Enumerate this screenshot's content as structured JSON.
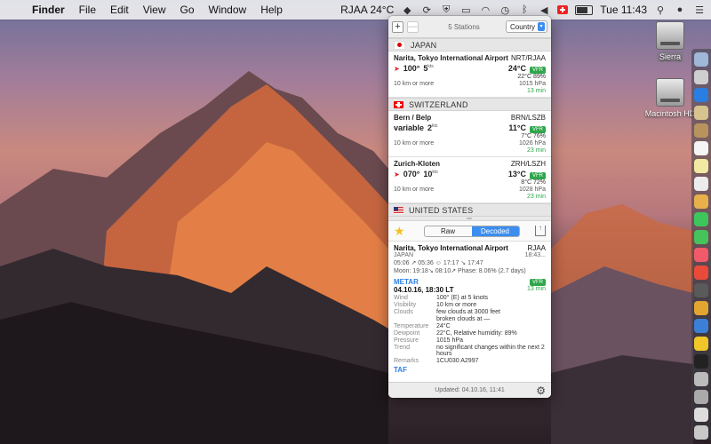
{
  "menubar": {
    "app": "Finder",
    "menus": [
      "File",
      "Edit",
      "View",
      "Go",
      "Window",
      "Help"
    ],
    "weather_status": "RJAA 24°C",
    "time": "Tue 11:43"
  },
  "panel": {
    "add_label": "+",
    "remove_label": "—",
    "stations_count": "5 Stations",
    "group_by": "Country",
    "groups": [
      {
        "country": "JAPAN",
        "stations": [
          {
            "name": "Narita, Tokyo International Airport",
            "code": "NRT/RJAA",
            "wind": "100°",
            "wind_speed": "5",
            "kts": "kts",
            "temp": "24°C",
            "flight_rule": "VFR",
            "dew_hum": "22°C 89%",
            "visibility": "10 km or more",
            "pressure": "1015 hPa",
            "age": "13 min"
          }
        ]
      },
      {
        "country": "SWITZERLAND",
        "stations": [
          {
            "name": "Bern / Belp",
            "code": "BRN/LSZB",
            "wind": "variable",
            "wind_speed": "2",
            "kts": "kts",
            "temp": "11°C",
            "flight_rule": "VFR",
            "dew_hum": "7°C 76%",
            "visibility": "10 km or more",
            "pressure": "1026 hPa",
            "age": "23 min"
          },
          {
            "name": "Zurich-Kloten",
            "code": "ZRH/LSZH",
            "wind": "070°",
            "wind_speed": "10",
            "kts": "kts",
            "temp": "13°C",
            "flight_rule": "VFR",
            "dew_hum": "8°C 72%",
            "visibility": "10 km or more",
            "pressure": "1028 hPa",
            "age": "23 min"
          }
        ]
      },
      {
        "country": "UNITED STATES",
        "stations": []
      }
    ],
    "detail": {
      "raw_label": "Raw",
      "decoded_label": "Decoded",
      "station_name": "Narita, Tokyo International Airport",
      "station_code": "RJAA",
      "country": "JAPAN",
      "local_time": "18:43...",
      "sun": "05:06 ↗ 05:36 ☺ 17:17 ↘ 17:47",
      "moon": "Moon: 19:18↘ 08:10↗ Phase: 8.06% (2.7 days)",
      "metar_label": "METAR",
      "flight_rule": "VFR",
      "metar_date": "04.10.16, 18:30 LT",
      "metar_age": "13 min",
      "rows": [
        {
          "k": "Wind",
          "v": "100° (E) at 5 knots"
        },
        {
          "k": "Visibility",
          "v": "10 km or more"
        },
        {
          "k": "Clouds",
          "v": "few clouds at 3000 feet"
        },
        {
          "k": "",
          "v": "broken clouds at —"
        },
        {
          "k": "Temperature",
          "v": "24°C"
        },
        {
          "k": "Dewpoint",
          "v": "22°C, Relative humidity: 89%"
        },
        {
          "k": "Pressure",
          "v": "1015 hPa"
        },
        {
          "k": "Trend",
          "v": "no significant changes within the next 2 hours"
        },
        {
          "k": "Remarks",
          "v": "1CU030 A2997"
        }
      ],
      "taf_label": "TAF"
    },
    "updated": "Updated: 04.10.16, 11:41"
  },
  "desktop": {
    "icons": [
      {
        "label": "Sierra"
      },
      {
        "label": "Macintosh HD"
      }
    ]
  }
}
